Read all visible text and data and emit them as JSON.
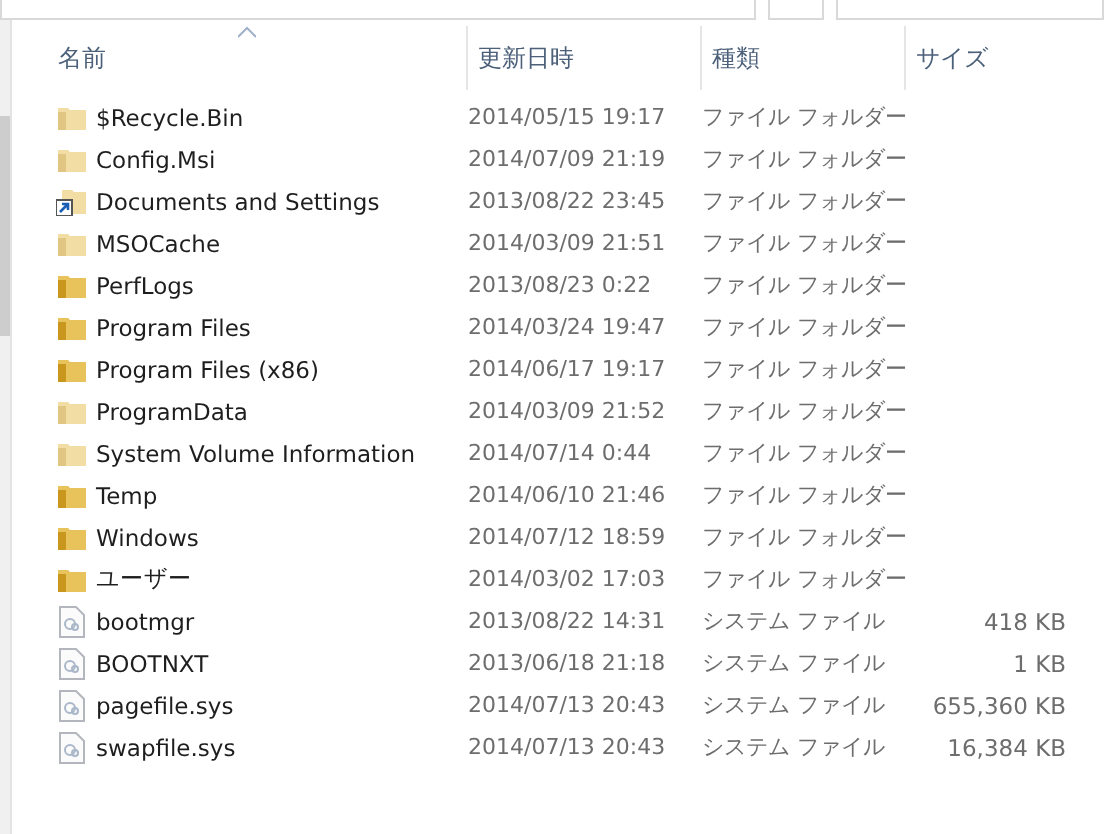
{
  "columns": [
    {
      "label": "名前",
      "sorted": true
    },
    {
      "label": "更新日時",
      "sorted": false
    },
    {
      "label": "種類",
      "sorted": false
    },
    {
      "label": "サイズ",
      "sorted": false
    }
  ],
  "rows": [
    {
      "kind": "folder",
      "hidden": true,
      "name": "$Recycle.Bin",
      "date": "2014/05/15 19:17",
      "type": "ファイル フォルダー"
    },
    {
      "kind": "folder",
      "hidden": true,
      "name": "Config.Msi",
      "date": "2014/07/09 21:19",
      "type": "ファイル フォルダー"
    },
    {
      "kind": "shortcut",
      "hidden": true,
      "name": "Documents and Settings",
      "date": "2013/08/22 23:45",
      "type": "ファイル フォルダー"
    },
    {
      "kind": "folder",
      "hidden": true,
      "name": "MSOCache",
      "date": "2014/03/09 21:51",
      "type": "ファイル フォルダー"
    },
    {
      "kind": "folder",
      "hidden": false,
      "name": "PerfLogs",
      "date": "2013/08/23 0:22",
      "type": "ファイル フォルダー"
    },
    {
      "kind": "folder",
      "hidden": false,
      "name": "Program Files",
      "date": "2014/03/24 19:47",
      "type": "ファイル フォルダー"
    },
    {
      "kind": "folder",
      "hidden": false,
      "name": "Program Files (x86)",
      "date": "2014/06/17 19:17",
      "type": "ファイル フォルダー"
    },
    {
      "kind": "folder",
      "hidden": true,
      "name": "ProgramData",
      "date": "2014/03/09 21:52",
      "type": "ファイル フォルダー"
    },
    {
      "kind": "folder",
      "hidden": true,
      "name": "System Volume Information",
      "date": "2014/07/14 0:44",
      "type": "ファイル フォルダー"
    },
    {
      "kind": "folder",
      "hidden": false,
      "name": "Temp",
      "date": "2014/06/10 21:46",
      "type": "ファイル フォルダー"
    },
    {
      "kind": "folder",
      "hidden": false,
      "name": "Windows",
      "date": "2014/07/12 18:59",
      "type": "ファイル フォルダー"
    },
    {
      "kind": "folder",
      "hidden": false,
      "name": "ユーザー",
      "date": "2014/03/02 17:03",
      "type": "ファイル フォルダー"
    },
    {
      "kind": "file",
      "hidden": true,
      "name": "bootmgr",
      "date": "2013/08/22 14:31",
      "type": "システム ファイル",
      "size": "418 KB"
    },
    {
      "kind": "file",
      "hidden": true,
      "name": "BOOTNXT",
      "date": "2013/06/18 21:18",
      "type": "システム ファイル",
      "size": "1 KB"
    },
    {
      "kind": "file",
      "hidden": true,
      "name": "pagefile.sys",
      "date": "2014/07/13 20:43",
      "type": "システム ファイル",
      "size": "655,360 KB"
    },
    {
      "kind": "file",
      "hidden": true,
      "name": "swapfile.sys",
      "date": "2014/07/13 20:43",
      "type": "システム ファイル",
      "size": "16,384 KB"
    }
  ]
}
